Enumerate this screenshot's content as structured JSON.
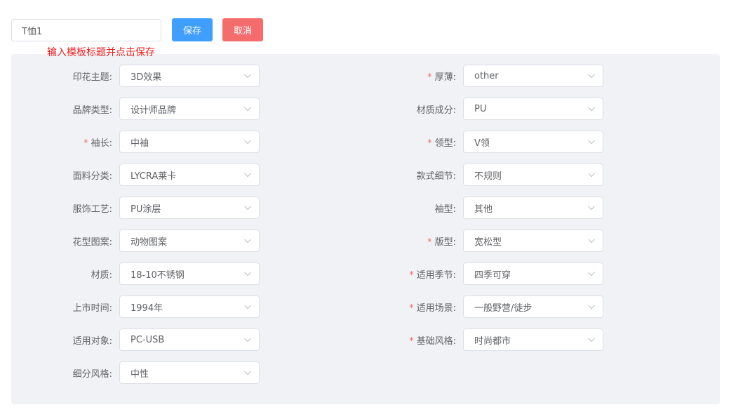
{
  "header": {
    "title_value": "T恤1",
    "save_label": "保存",
    "cancel_label": "取消",
    "hint": "输入模板标题并点击保存"
  },
  "colors": {
    "primary": "#409eff",
    "danger": "#f56c6c",
    "hint": "#f01c1c",
    "panel_bg": "#f1f2f5"
  },
  "form": {
    "left": [
      {
        "label": "印花主题:",
        "required": false,
        "value": "3D效果"
      },
      {
        "label": "品牌类型:",
        "required": false,
        "value": "设计师品牌"
      },
      {
        "label": "袖长:",
        "required": true,
        "value": "中袖"
      },
      {
        "label": "面料分类:",
        "required": false,
        "value": "LYCRA莱卡"
      },
      {
        "label": "服饰工艺:",
        "required": false,
        "value": "PU涂层"
      },
      {
        "label": "花型图案:",
        "required": false,
        "value": "动物图案"
      },
      {
        "label": "材质:",
        "required": false,
        "value": "18-10不锈钢"
      },
      {
        "label": "上市时间:",
        "required": false,
        "value": "1994年"
      },
      {
        "label": "适用对象:",
        "required": false,
        "value": "PC-USB"
      },
      {
        "label": "细分风格:",
        "required": false,
        "value": "中性"
      }
    ],
    "right": [
      {
        "label": "厚薄:",
        "required": true,
        "value": "other"
      },
      {
        "label": "材质成分:",
        "required": false,
        "value": "PU"
      },
      {
        "label": "领型:",
        "required": true,
        "value": "V领"
      },
      {
        "label": "款式细节:",
        "required": false,
        "value": "不规则"
      },
      {
        "label": "袖型:",
        "required": false,
        "value": "其他"
      },
      {
        "label": "版型:",
        "required": true,
        "value": "宽松型"
      },
      {
        "label": "适用季节:",
        "required": true,
        "value": "四季可穿"
      },
      {
        "label": "适用场景:",
        "required": true,
        "value": "一般野营/徒步"
      },
      {
        "label": "基础风格:",
        "required": true,
        "value": "时尚都市"
      }
    ]
  }
}
